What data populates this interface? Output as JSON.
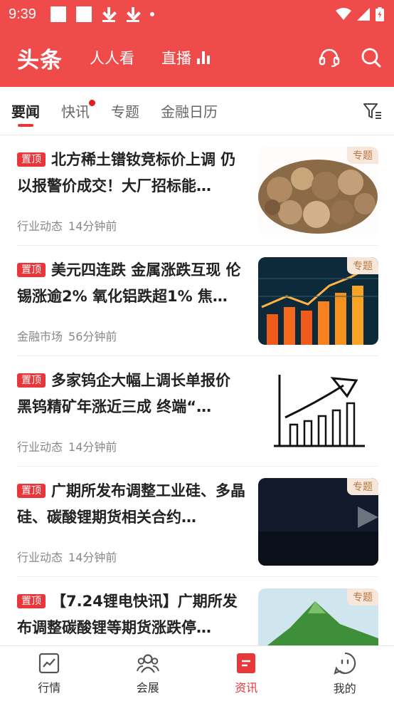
{
  "status": {
    "time": "9:39"
  },
  "header": {
    "brand": "头条",
    "nav": [
      "人人看",
      "直播"
    ]
  },
  "tabs": [
    {
      "label": "要闻"
    },
    {
      "label": "快讯"
    },
    {
      "label": "专题"
    },
    {
      "label": "金融日历"
    }
  ],
  "news": [
    {
      "pin": "置顶",
      "title": "北方稀土镨钕竞标价上调 仍以报警价成交！大厂招标能…",
      "category": "行业动态",
      "time": "14分钟前",
      "tag": "专题"
    },
    {
      "pin": "置顶",
      "title": "美元四连跌 金属涨跌互现 伦锡涨逾2% 氧化铝跌超1% 焦…",
      "category": "金融市场",
      "time": "56分钟前",
      "tag": "专题"
    },
    {
      "pin": "置顶",
      "title": "多家钨企大幅上调长单报价 黑钨精矿年涨近三成 终端“…",
      "category": "行业动态",
      "time": "14分钟前",
      "tag": ""
    },
    {
      "pin": "置顶",
      "title": "广期所发布调整工业硅、多晶硅、碳酸锂期货相关合约…",
      "category": "行业动态",
      "time": "14分钟前",
      "tag": "专题"
    },
    {
      "pin": "置顶",
      "title": "【7.24锂电快讯】广期所发布调整碳酸锂等期货涨跌停…",
      "category": "",
      "time": "",
      "tag": "专题"
    }
  ],
  "bottom_nav": [
    {
      "label": "行情"
    },
    {
      "label": "会展"
    },
    {
      "label": "资讯"
    },
    {
      "label": "我的"
    }
  ],
  "colors": {
    "brand_red": "#f04b4b",
    "accent": "#e8363b"
  }
}
